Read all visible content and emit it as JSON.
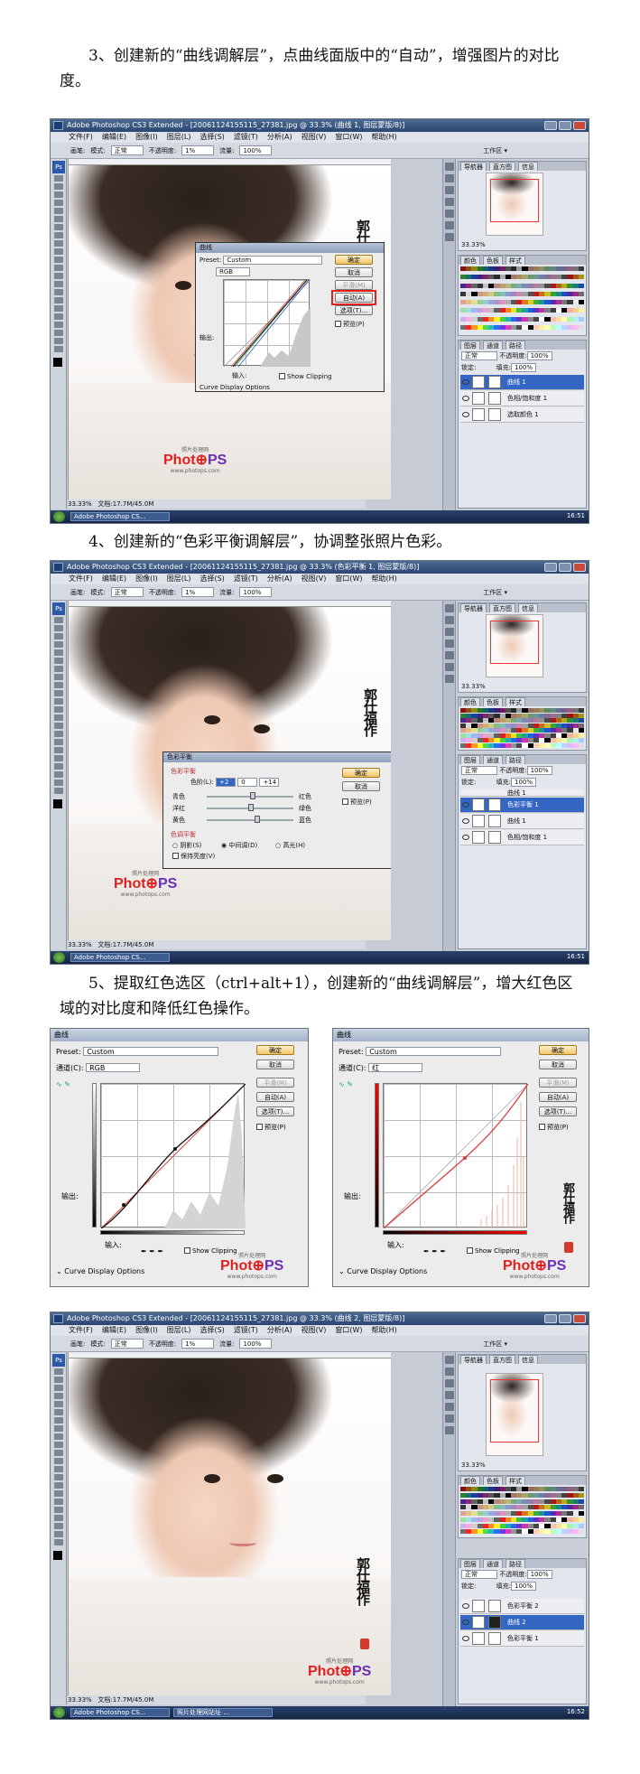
{
  "steps": [
    {
      "text": "3、创建新的“曲线调解层”，点曲线面版中的“自动”，增强图片的对比度。"
    },
    {
      "text": "4、创建新的“色彩平衡调解层”，协调整张照片色彩。"
    },
    {
      "text": "5、提取红色选区（ctrl+alt+1），创建新的“曲线调解层”，增大红色区域的对比度和降低红色操作。"
    }
  ],
  "ps": {
    "title1": "Adobe Photoshop CS3 Extended - [20061124155115_27381.jpg @ 33.3% (曲线 1, 图层蒙版/8)]",
    "title2": "Adobe Photoshop CS3 Extended - [20061124155115_27381.jpg @ 33.3% (色彩平衡 1, 图层蒙版/8)]",
    "title3": "Adobe Photoshop CS3 Extended - [20061124155115_27381.jpg @ 33.3% (曲线 2, 图层蒙版/8)]",
    "menus": [
      "文件(F)",
      "编辑(E)",
      "图像(I)",
      "图层(L)",
      "选择(S)",
      "滤镜(T)",
      "分析(A)",
      "视图(V)",
      "窗口(W)",
      "帮助(H)"
    ],
    "opt": {
      "brush": "画笔:",
      "mode": "模式:",
      "mode_val": "正常",
      "opacity": "不透明度:",
      "opacity_val": "1%",
      "flow": "流量:",
      "flow_val": "100%",
      "workspace": "工作区 ▾"
    },
    "nav_tabs": [
      "导航器",
      "直方图",
      "信息"
    ],
    "zoom": "33.33%",
    "color_tabs": [
      "颜色",
      "色板",
      "样式"
    ],
    "layer_tabs": [
      "图层",
      "通道",
      "路径"
    ],
    "blend": "正常",
    "opacity_label": "不透明度:",
    "opacity_val": "100%",
    "lock_label": "锁定:",
    "fill_label": "填充:",
    "fill_val": "100%",
    "status_zoom": "33.33%",
    "status_doc": "文档:17.7M/45.0M",
    "task_app": "Adobe Photoshop CS...",
    "task_app2": "照片处理网站址 ...",
    "clock1": "16:51",
    "clock2": "16:52",
    "layers1": [
      "曲线 1",
      "色相/饱和度 1",
      "选取颜色 1"
    ],
    "layers2": [
      "曲线 1",
      "色彩平衡 1",
      "曲线 1",
      "色相/饱和度 1"
    ],
    "layers3": [
      "色彩平衡 2",
      "曲线 2",
      "色彩平衡 1"
    ]
  },
  "curves": {
    "title": "曲线",
    "preset_label": "Preset:",
    "preset_val": "Custom",
    "channel_label": "通道(C):",
    "channel_rgb": "RGB",
    "channel_red": "红",
    "ok": "确定",
    "cancel": "取消",
    "smooth": "平滑(M)",
    "auto": "自动(A)",
    "options": "选项(T)...",
    "preview": "预览(P)",
    "output": "输出:",
    "input": "输入:",
    "show_clipping": "Show Clipping",
    "curve_display": "Curve Display Options"
  },
  "colorbalance": {
    "title": "色彩平衡",
    "section": "色彩平衡",
    "levels_label": "色阶(L):",
    "levels": [
      "+2",
      "0",
      "+14"
    ],
    "left": [
      "青色",
      "洋红",
      "黄色"
    ],
    "right": [
      "红色",
      "绿色",
      "蓝色"
    ],
    "tone_section": "色调平衡",
    "tones": [
      "阴影(S)",
      "中间调(D)",
      "高光(H)"
    ],
    "preserve": "保持亮度(V)",
    "ok": "确定",
    "cancel": "取消",
    "preview": "预览(P)"
  },
  "watermark": {
    "small": "照片处理网",
    "brand_a": "Phot",
    "brand_b": "PS",
    "url": "www.photops.com"
  },
  "calligraphy": "郭仕福作"
}
